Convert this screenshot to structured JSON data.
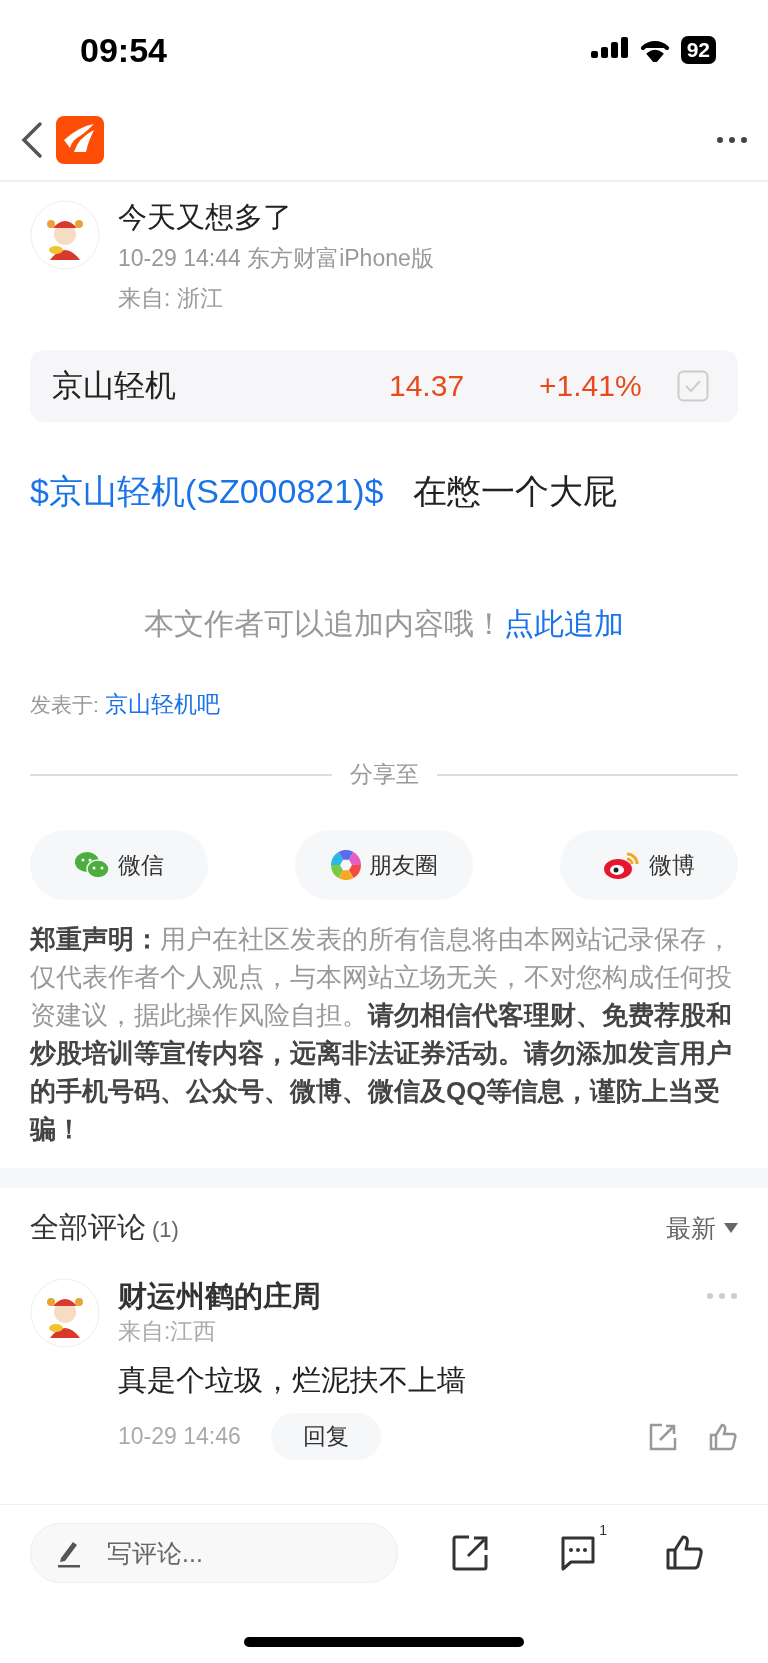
{
  "status_bar": {
    "time": "09:54",
    "battery": "92"
  },
  "post": {
    "author": "今天又想多了",
    "meta": "10-29 14:44 东方财富iPhone版",
    "location": "来自: 浙江"
  },
  "stock": {
    "name": "京山轻机",
    "price": "14.37",
    "change": "+1.41%"
  },
  "body": {
    "link": "$京山轻机(SZ000821)$",
    "text": "在憋一个大屁"
  },
  "append": {
    "text": "本文作者可以追加内容哦！",
    "link": "点此追加"
  },
  "posted_in": {
    "label": "发表于:",
    "link": "京山轻机吧"
  },
  "share": {
    "title": "分享至",
    "buttons": [
      {
        "kind": "wechat",
        "label": "微信"
      },
      {
        "kind": "moments",
        "label": "朋友圈"
      },
      {
        "kind": "weibo",
        "label": "微博"
      }
    ]
  },
  "disclaimer": "**郑重声明：**用户在社区发表的所有信息将由本网站记录保存，仅代表作者个人观点，与本网站立场无关，不对您构成任何投资建议，据此操作风险自担。**请勿相信代客理财、免费荐股和炒股培训等宣传内容，远离非法证券活动。请勿添加发言用户的手机号码、公众号、微博、微信及QQ等信息，谨防上当受骗！**",
  "comments": {
    "title": "全部评论",
    "count": "(1)",
    "sort": "最新",
    "items": [
      {
        "name": "财运州鹤的庄周",
        "location": "来自:江西",
        "text": "真是个垃圾，烂泥扶不上墙",
        "time": "10-29 14:46",
        "reply": "回复"
      }
    ]
  },
  "bottom_bar": {
    "placeholder": "写评论...",
    "comment_count": "1"
  }
}
